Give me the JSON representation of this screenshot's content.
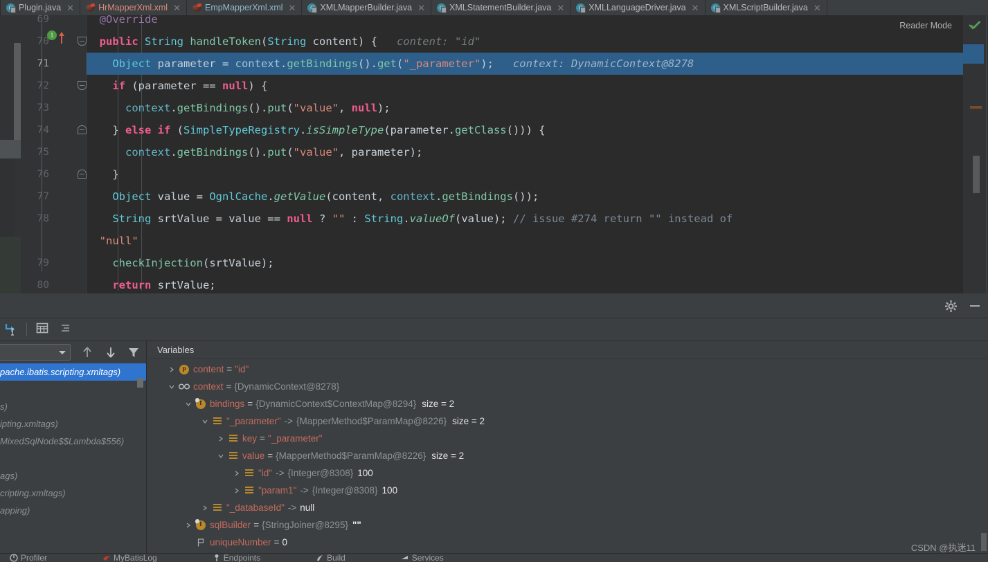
{
  "window": {
    "theme_bg": "#2b2b2b",
    "panel_bg": "#3c3f41",
    "accent_selection": "#2e5e8a",
    "accent_tree_selection": "#2f75d0"
  },
  "tabs": [
    {
      "label": "Plugin.java",
      "icon": "java-class-icon",
      "kind": "java",
      "active": false
    },
    {
      "label": "HrMapperXml.xml",
      "icon": "xml-file-icon",
      "kind": "xml",
      "active": false
    },
    {
      "label": "EmpMapperXml.xml",
      "icon": "xml-file-icon",
      "kind": "xml2",
      "active": false
    },
    {
      "label": "XMLMapperBuilder.java",
      "icon": "java-class-icon",
      "kind": "java",
      "active": false
    },
    {
      "label": "XMLStatementBuilder.java",
      "icon": "java-class-icon",
      "kind": "java",
      "active": false
    },
    {
      "label": "XMLLanguageDriver.java",
      "icon": "java-class-icon",
      "kind": "java",
      "active": false
    },
    {
      "label": "XMLScriptBuilder.java",
      "icon": "java-class-icon",
      "kind": "java",
      "active": true
    }
  ],
  "editor": {
    "reader_mode_label": "Reader Mode",
    "current_line": 71,
    "lines": [
      {
        "n": 69,
        "partial_top": true
      },
      {
        "n": 70,
        "has_run_marker": true,
        "run_marker_glyph": "1",
        "fold": "down"
      },
      {
        "n": 71,
        "highlight": true
      },
      {
        "n": 72,
        "fold": "down"
      },
      {
        "n": 73
      },
      {
        "n": 74,
        "fold": "up"
      },
      {
        "n": 75
      },
      {
        "n": 76,
        "fold": "up"
      },
      {
        "n": 77
      },
      {
        "n": 78
      },
      {
        "n": null,
        "wrapped": true
      },
      {
        "n": 79
      },
      {
        "n": 80
      }
    ],
    "inline_hints": [
      {
        "line": 70,
        "text": "content: \"id\""
      },
      {
        "line": 71,
        "text": "context: DynamicContext@8278"
      }
    ],
    "code_text": {
      "l69": "@Override",
      "l70": "public String handleToken(String content) {",
      "l71": "Object parameter = context.getBindings().get(\"_parameter\");",
      "l72": "if (parameter == null) {",
      "l73": "context.getBindings().put(\"value\", null);",
      "l74": "} else if (SimpleTypeRegistry.isSimpleType(parameter.getClass())) {",
      "l75": "context.getBindings().put(\"value\", parameter);",
      "l76": "}",
      "l77": "Object value = OgnlCache.getValue(content, context.getBindings());",
      "l78": "String srtValue = value == null ? \"\" : String.valueOf(value); // issue #274 return \"\" instead of",
      "l78b": "\"null\"",
      "l79": "checkInjection(srtValue);",
      "l80": "return srtValue;"
    }
  },
  "debug_panel": {
    "toolbar_icons": [
      {
        "name": "evaluate-expression-icon"
      },
      {
        "name": "table-view-icon"
      },
      {
        "name": "sort-variables-icon"
      }
    ],
    "settings_icon": "gear-icon",
    "minimize_icon": "minimize-icon",
    "layout_icon": "layout-settings-icon",
    "frames": {
      "thread_select_value": "",
      "rows": [
        {
          "text": "pache.ibatis.scripting.xmltags)",
          "selected": true
        },
        {
          "text": "",
          "selected": false
        },
        {
          "text": "s)",
          "selected": false
        },
        {
          "text": "ipting.xmltags)",
          "selected": false
        },
        {
          "text": "MixedSqlNode$$Lambda$556)",
          "selected": false
        },
        {
          "text": "",
          "selected": false
        },
        {
          "text": "ags)",
          "selected": false
        },
        {
          "text": "cripting.xmltags)",
          "selected": false
        },
        {
          "text": "apping)",
          "selected": false
        }
      ],
      "icons": [
        {
          "name": "step-up-icon"
        },
        {
          "name": "step-down-icon"
        },
        {
          "name": "filter-icon"
        }
      ]
    },
    "rail_buttons": [
      {
        "name": "add-watch-button",
        "glyph": "+",
        "active": false
      },
      {
        "name": "remove-watch-button",
        "glyph": "−",
        "active": false
      },
      {
        "name": "move-up-button",
        "glyph": "up",
        "active": false
      },
      {
        "name": "move-down-button",
        "glyph": "down",
        "active": false
      },
      {
        "name": "copy-value-button",
        "glyph": "copy",
        "active": false
      },
      {
        "name": "watches-toggle",
        "glyph": "glasses",
        "active": true
      }
    ],
    "variables": {
      "header": "Variables",
      "rows": [
        {
          "depth": 0,
          "twisty": "collapsed",
          "icon": "param-icon",
          "name": "content",
          "sep": " = ",
          "value": "\"id\"",
          "value_kind": "str",
          "size": ""
        },
        {
          "depth": 0,
          "twisty": "expanded",
          "icon": "watch-icon",
          "name": "context",
          "sep": " = ",
          "value": "{DynamicContext@8278}",
          "value_kind": "dim",
          "size": ""
        },
        {
          "depth": 1,
          "twisty": "expanded",
          "icon": "field-icon",
          "name": "bindings",
          "sep": " = ",
          "value": "{DynamicContext$ContextMap@8294}",
          "value_kind": "dim",
          "size": "size = 2"
        },
        {
          "depth": 2,
          "twisty": "expanded",
          "icon": "entry-icon",
          "name": "\"_parameter\"",
          "sep": " -> ",
          "value": "{MapperMethod$ParamMap@8226}",
          "value_kind": "dim",
          "size": "size = 2"
        },
        {
          "depth": 3,
          "twisty": "collapsed",
          "icon": "entry-icon",
          "name": "key",
          "sep": " = ",
          "value": "\"_parameter\"",
          "value_kind": "str",
          "size": ""
        },
        {
          "depth": 3,
          "twisty": "expanded",
          "icon": "entry-icon",
          "name": "value",
          "sep": " = ",
          "value": "{MapperMethod$ParamMap@8226}",
          "value_kind": "dim",
          "size": "size = 2"
        },
        {
          "depth": 4,
          "twisty": "collapsed",
          "icon": "entry-icon",
          "name": "\"id\"",
          "sep": " -> ",
          "value": "{Integer@8308}",
          "value_kind": "dim",
          "size": "",
          "extra": "100"
        },
        {
          "depth": 4,
          "twisty": "collapsed",
          "icon": "entry-icon",
          "name": "\"param1\"",
          "sep": " -> ",
          "value": "{Integer@8308}",
          "value_kind": "dim",
          "size": "",
          "extra": "100"
        },
        {
          "depth": 2,
          "twisty": "collapsed",
          "icon": "entry-icon",
          "name": "\"_databaseId\"",
          "sep": " -> ",
          "value": "null",
          "value_kind": "num",
          "size": ""
        },
        {
          "depth": 1,
          "twisty": "collapsed",
          "icon": "field-icon",
          "name": "sqlBuilder",
          "sep": " = ",
          "value": "{StringJoiner@8295}",
          "value_kind": "dim",
          "size": "",
          "extra": "\"\""
        },
        {
          "depth": 1,
          "twisty": "none",
          "icon": "static-icon",
          "name": "uniqueNumber",
          "sep": " = ",
          "value": "0",
          "value_kind": "num",
          "size": ""
        }
      ]
    }
  },
  "bottom_bar": {
    "items": [
      {
        "label": "Profiler",
        "icon": "profiler-icon"
      },
      {
        "label": "MyBatisLog",
        "icon": "mybatis-icon"
      },
      {
        "label": "Endpoints",
        "icon": "endpoints-icon"
      },
      {
        "label": "Build",
        "icon": "build-icon"
      },
      {
        "label": "Services",
        "icon": "services-icon"
      }
    ]
  },
  "watermark": {
    "text": "CSDN @执迷11"
  }
}
